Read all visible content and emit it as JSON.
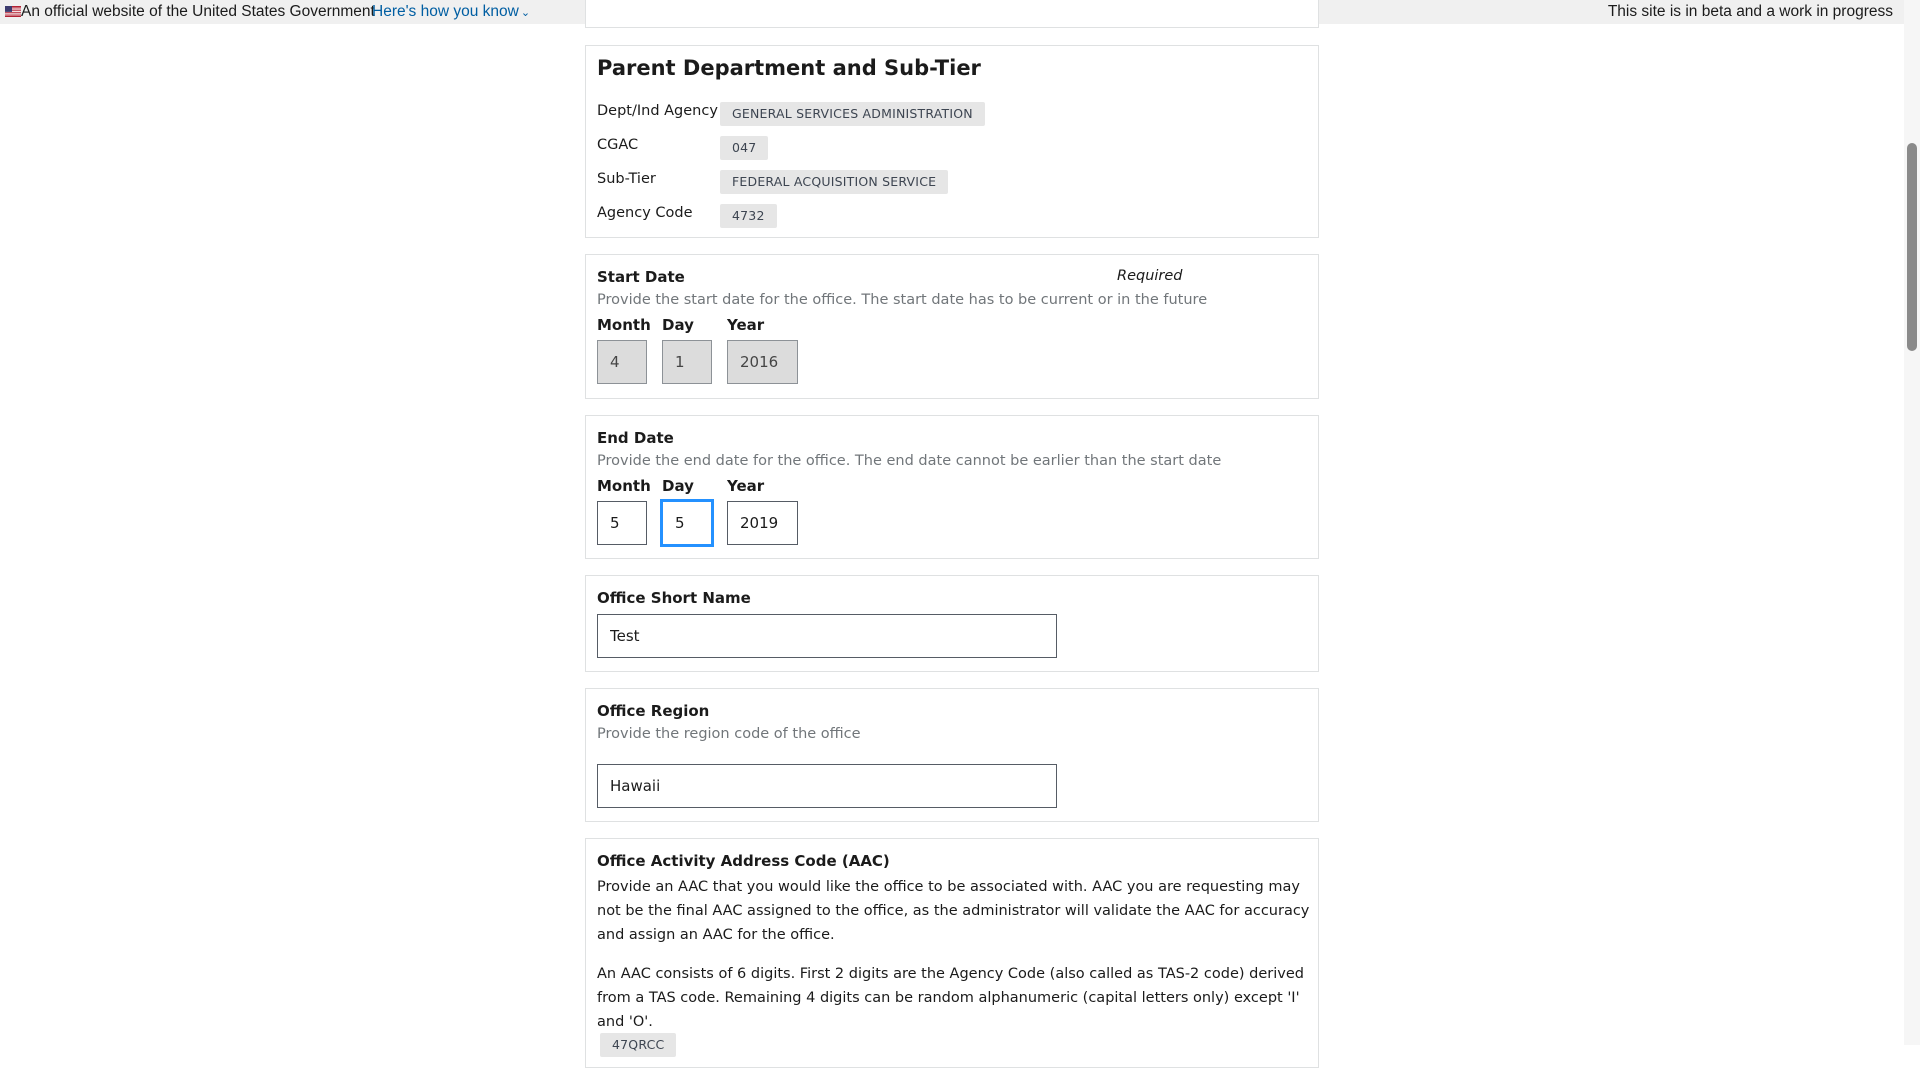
{
  "banner": {
    "official_text": "An official website of the United States Government",
    "how_you_know": "Here's how you know",
    "beta_text": "This site is in beta and a work in progress"
  },
  "parent_section": {
    "title": "Parent Department and Sub-Tier",
    "rows": [
      {
        "label": "Dept/Ind Agency",
        "value": "GENERAL SERVICES ADMINISTRATION"
      },
      {
        "label": "CGAC",
        "value": "047"
      },
      {
        "label": "Sub-Tier",
        "value": "FEDERAL ACQUISITION SERVICE"
      },
      {
        "label": "Agency Code",
        "value": "4732"
      }
    ]
  },
  "start_date": {
    "title": "Start Date",
    "required": "Required",
    "hint": "Provide the start date for the office. The start date has to be current or in the future",
    "month_label": "Month",
    "day_label": "Day",
    "year_label": "Year",
    "month": "4",
    "day": "1",
    "year": "2016"
  },
  "end_date": {
    "title": "End Date",
    "hint": "Provide the end date for the office. The end date cannot be earlier than the start date",
    "month_label": "Month",
    "day_label": "Day",
    "year_label": "Year",
    "month": "5",
    "day": "5",
    "year": "2019"
  },
  "short_name": {
    "title": "Office Short Name",
    "value": "Test"
  },
  "region": {
    "title": "Office Region",
    "hint": "Provide the region code of the office",
    "value": "Hawaii"
  },
  "aac": {
    "title": "Office Activity Address Code (AAC)",
    "para1": "Provide an AAC that you would like the office to be associated with. AAC you are requesting may not be the final AAC assigned to the office, as the administrator will validate the AAC for accuracy and assign an AAC for the office.",
    "para2": "An AAC consists of 6 digits. First 2 digits are the Agency Code (also called as TAS-2 code) derived from a TAS code. Remaining 4 digits can be random alphanumeric (capital letters only) except 'I' and 'O'.",
    "value": "47QRCC"
  },
  "colors": {
    "link": "#005ea2",
    "focus": "#2491ff",
    "tag_bg": "#e6e6e6"
  }
}
